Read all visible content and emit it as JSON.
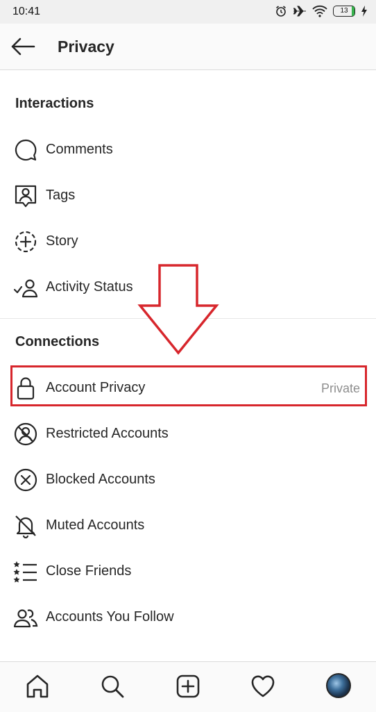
{
  "status_bar": {
    "time": "10:41",
    "battery": "13",
    "icons": [
      "alarm-icon",
      "airplane-icon",
      "wifi-icon",
      "battery-icon",
      "charging-icon"
    ]
  },
  "header": {
    "title": "Privacy",
    "back_icon": "back-arrow-icon"
  },
  "sections": {
    "interactions": {
      "title": "Interactions",
      "items": [
        {
          "label": "Comments",
          "icon": "comment-icon"
        },
        {
          "label": "Tags",
          "icon": "tag-person-icon"
        },
        {
          "label": "Story",
          "icon": "story-plus-icon"
        },
        {
          "label": "Activity Status",
          "icon": "activity-status-icon"
        }
      ]
    },
    "connections": {
      "title": "Connections",
      "items": [
        {
          "label": "Account Privacy",
          "value": "Private",
          "icon": "lock-icon",
          "highlighted": true
        },
        {
          "label": "Restricted Accounts",
          "icon": "restricted-icon"
        },
        {
          "label": "Blocked Accounts",
          "icon": "blocked-icon"
        },
        {
          "label": "Muted Accounts",
          "icon": "muted-bell-icon"
        },
        {
          "label": "Close Friends",
          "icon": "close-friends-icon"
        },
        {
          "label": "Accounts You Follow",
          "icon": "following-icon"
        }
      ]
    }
  },
  "annotation": {
    "arrow_color": "#d7262c",
    "box_color": "#d7262c"
  },
  "bottom_nav": {
    "items": [
      "home-icon",
      "search-icon",
      "new-post-icon",
      "activity-heart-icon",
      "profile-avatar"
    ]
  }
}
